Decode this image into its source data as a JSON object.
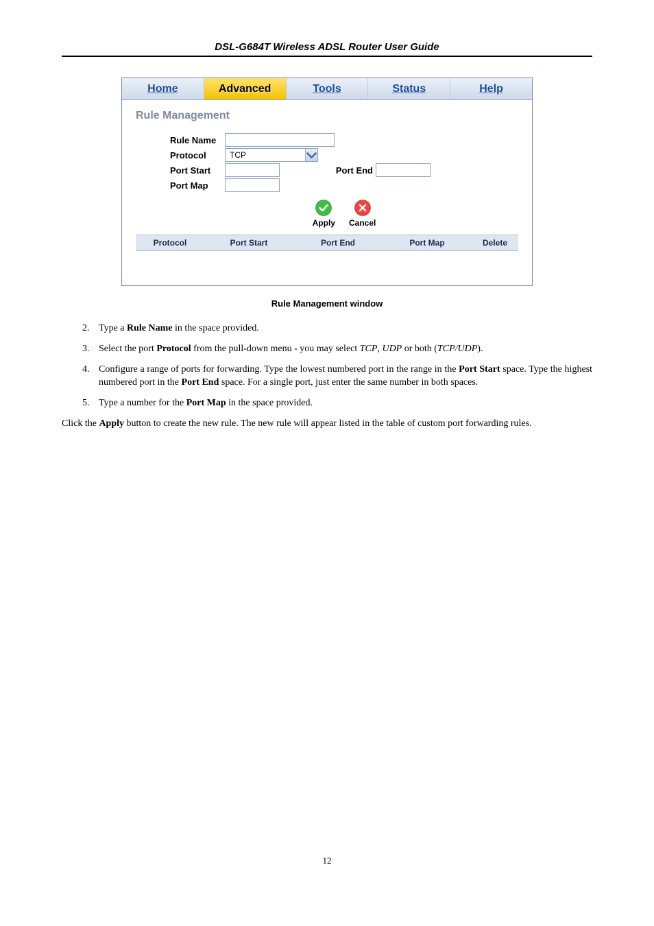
{
  "header": {
    "title": "DSL-G684T Wireless ADSL Router User Guide"
  },
  "ui": {
    "tabs": {
      "home": "Home",
      "advanced": "Advanced",
      "tools": "Tools",
      "status": "Status",
      "help": "Help"
    },
    "section_title": "Rule Management",
    "form": {
      "rule_name_label": "Rule Name",
      "protocol_label": "Protocol",
      "protocol_value": "TCP",
      "port_start_label": "Port Start",
      "port_end_label": "Port End",
      "port_map_label": "Port Map"
    },
    "buttons": {
      "apply": "Apply",
      "cancel": "Cancel"
    },
    "table": {
      "protocol": "Protocol",
      "port_start": "Port Start",
      "port_end": "Port End",
      "port_map": "Port Map",
      "delete": "Delete"
    }
  },
  "caption": "Rule Management window",
  "steps": {
    "s2_a": "Type a ",
    "s2_b": "Rule Name",
    "s2_c": " in the space provided.",
    "s3_a": "Select the port ",
    "s3_b": "Protocol",
    "s3_c": " from the pull-down menu - you may select ",
    "s3_d": "TCP",
    "s3_e": ", ",
    "s3_f": "UDP",
    "s3_g": " or both (",
    "s3_h": "TCP/UDP",
    "s3_i": ").",
    "s4_a": "Configure a range of ports for forwarding. Type the lowest numbered port in the range in the ",
    "s4_b": "Port Start",
    "s4_c": " space. Type the highest numbered port in the ",
    "s4_d": "Port End",
    "s4_e": " space. For a single port, just enter the same number in both spaces.",
    "s5_a": "Type a number for the ",
    "s5_b": "Port Map",
    "s5_c": " in the space provided."
  },
  "closing": {
    "a": "Click the ",
    "b": "Apply",
    "c": " button to create the new rule. The new rule will appear listed in the table of custom port forwarding rules."
  },
  "page_number": "12"
}
